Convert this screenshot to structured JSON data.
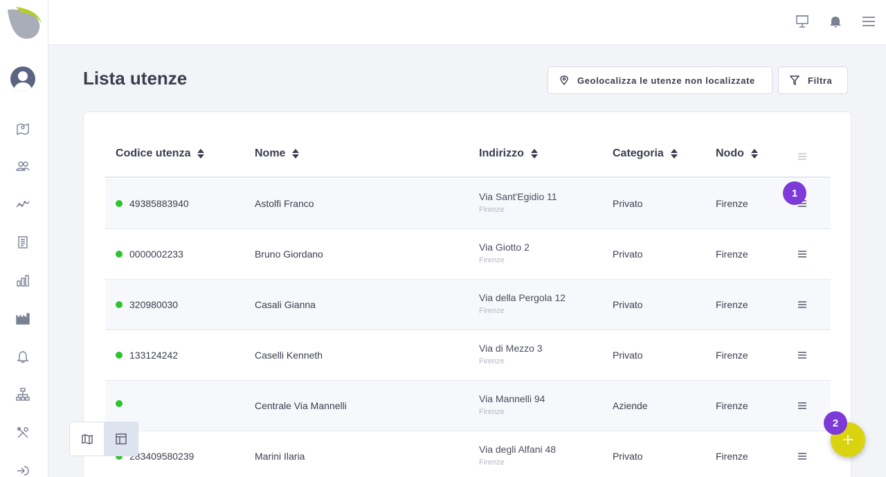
{
  "header": {
    "page_title": "Lista utenze",
    "geolocate_button": "Geolocalizza le utenze non localizzate",
    "filter_button": "Filtra"
  },
  "sidebar": {
    "items": [
      "map-icon",
      "users-icon",
      "trend-icon",
      "document-icon",
      "bar-chart-icon",
      "factory-icon",
      "bell-icon",
      "hierarchy-icon",
      "tools-icon",
      "logout-icon"
    ]
  },
  "topbar": {
    "icons": [
      "presentation-icon",
      "notification-bell-icon",
      "hamburger-menu-icon"
    ]
  },
  "table": {
    "columns": [
      "Codice utenza",
      "Nome",
      "Indirizzo",
      "Categoria",
      "Nodo"
    ],
    "rows": [
      {
        "code": "49385883940",
        "name": "Astolfi Franco",
        "street": "Via Sant'Egidio 11",
        "city": "Firenze",
        "category": "Privato",
        "node": "Firenze"
      },
      {
        "code": "0000002233",
        "name": "Bruno Giordano",
        "street": "Via Giotto 2",
        "city": "Firenze",
        "category": "Privato",
        "node": "Firenze"
      },
      {
        "code": "320980030",
        "name": "Casali Gianna",
        "street": "Via della Pergola 12",
        "city": "Firenze",
        "category": "Privato",
        "node": "Firenze"
      },
      {
        "code": "133124242",
        "name": "Caselli Kenneth",
        "street": "Via di Mezzo 3",
        "city": "Firenze",
        "category": "Privato",
        "node": "Firenze"
      },
      {
        "code": "",
        "name": "Centrale Via Mannelli",
        "street": "Via Mannelli 94",
        "city": "Firenze",
        "category": "Aziende",
        "node": "Firenze"
      },
      {
        "code": "283409580239",
        "name": "Marini Ilaria",
        "street": "Via degli Alfani 48",
        "city": "Firenze",
        "category": "Privato",
        "node": "Firenze"
      }
    ]
  },
  "badges": {
    "first": "1",
    "second": "2"
  },
  "colors": {
    "accent": "#d9d40f",
    "badge": "#7e3ad8",
    "status_active": "#2ec42e"
  }
}
